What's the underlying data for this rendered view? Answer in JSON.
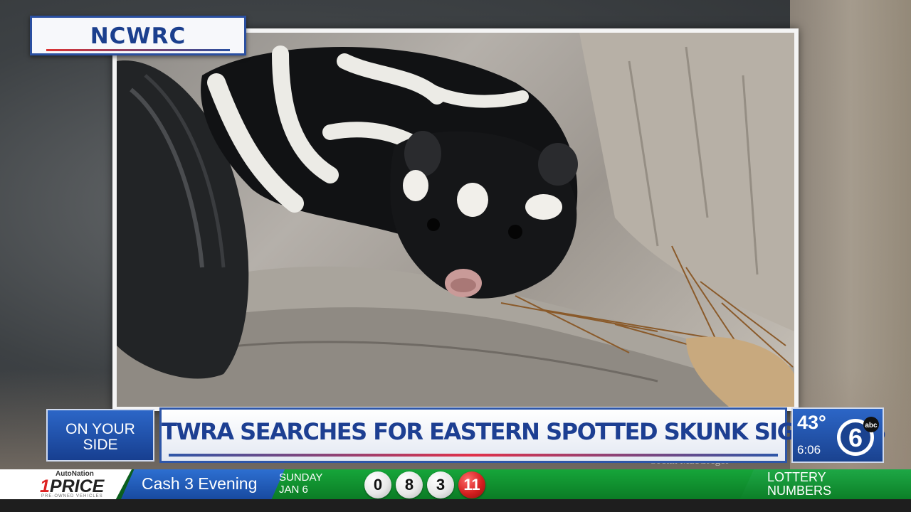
{
  "source_tag": "NCWRC",
  "photo_credit": "©John MacGregor",
  "segment": {
    "line1": "ON YOUR",
    "line2": "SIDE"
  },
  "headline": "TWRA SEARCHES FOR EASTERN SPOTTED SKUNK SIGHTINGS",
  "weather": {
    "temp": "43°",
    "time": "6:06",
    "station_number": "6",
    "network": "abc"
  },
  "ticker": {
    "sponsor": {
      "top": "AutoNation",
      "brand_num": "1",
      "brand": "PRICE",
      "sub": "PRE-OWNED VEHICLES"
    },
    "game": "Cash 3 Evening",
    "day": "SUNDAY",
    "date": "JAN 6",
    "balls": [
      "0",
      "8",
      "3",
      "11"
    ],
    "label_line1": "LOTTERY",
    "label_line2": "NUMBERS"
  },
  "colors": {
    "brand_blue": "#1d3f92",
    "accent_red": "#e0304a",
    "ticker_green": "#16a63a"
  }
}
